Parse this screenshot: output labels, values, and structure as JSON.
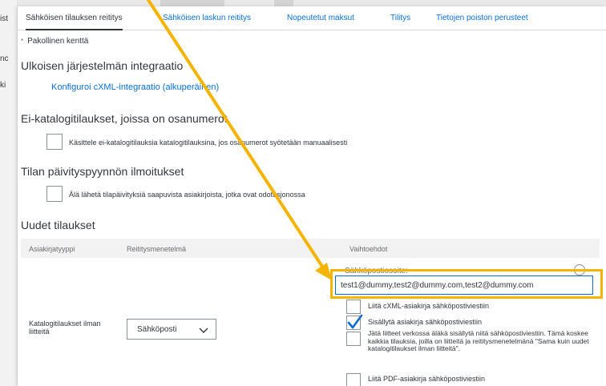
{
  "background_left_fragments": [
    "ist",
    "nc",
    "ki"
  ],
  "tabs": [
    {
      "label": "Sähköisen tilauksen reititys",
      "active": true
    },
    {
      "label": "Sähköisen laskun reititys",
      "active": false
    },
    {
      "label": "Nopeutetut maksut",
      "active": false
    },
    {
      "label": "Tilitys",
      "active": false
    },
    {
      "label": "Tietojen poiston perusteet",
      "active": false
    }
  ],
  "required_note": {
    "star": "*",
    "text": "Pakollinen kenttä"
  },
  "external_integration": {
    "heading": "Ulkoisen järjestelmän integraatio",
    "link": "Konfiguroi cXML-integraatio (alkuperäinen)"
  },
  "non_catalog": {
    "heading": "Ei-katalogitilaukset, joissa on osanumerot",
    "checkbox_label": "Käsittele ei-katalogitilauksia katalogitilauksina, jos osanumerot syötetään manuaalisesti",
    "checked": false
  },
  "status_notifications": {
    "heading": "Tilan päivityspyynnön ilmoitukset",
    "checkbox_label": "Älä lähetä tilapäivityksiä saapuvista asiakirjoista, jotka ovat odotusjonossa",
    "checked": false
  },
  "new_orders": {
    "heading": "Uudet tilaukset",
    "columns": [
      "Asiakirjatyyppi",
      "Reititysmenetelmä",
      "Vaihtoehdot"
    ],
    "row": {
      "document_type": "Katalogitilaukset ilman liitteitä",
      "routing_method": "Sähköposti",
      "email_label": "Sähköpostiosoite:",
      "email_value": "test1@dummy,test2@dummy.com,test2@dummy.com",
      "options": [
        {
          "label": "Liitä cXML-asiakirja sähköpostiviestiin",
          "checked": false
        },
        {
          "label": "Sisällytä asiakirja sähköpostiviestiin",
          "checked": true
        },
        {
          "label": "Jätä liitteet verkossa äläkä sisällytä niitä sähköpostiviestiin.  Tämä koskee kaikkia tilauksia, joilla on liitteitä ja reititysmenetelmänä \"Sama kuin uudet katalogitilaukset ilman liitteitä\".",
          "checked": false
        },
        {
          "label": "Liitä PDF-asiakirja sähköpostiviestiin",
          "checked": false
        }
      ]
    }
  },
  "colors": {
    "accent": "#0a6ed1",
    "highlight": "#f5b400",
    "text": "#32363a",
    "muted": "#6a6d70"
  }
}
